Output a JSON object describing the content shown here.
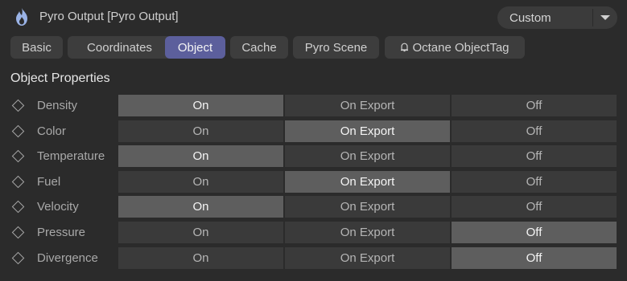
{
  "header": {
    "title": "Pyro Output [Pyro Output]",
    "preset": "Custom",
    "flame_icon": "pyro-flame-icon",
    "arrow_icon": "chevron-down-icon"
  },
  "tabs": [
    {
      "label": "Basic",
      "active": false
    },
    {
      "label": "Coordinates",
      "active": false
    },
    {
      "label": "Object",
      "active": true
    },
    {
      "label": "Cache",
      "active": false
    },
    {
      "label": "Pyro Scene",
      "active": false
    },
    {
      "label": "Octane ObjectTag",
      "active": false,
      "icon": "bell-icon"
    }
  ],
  "section": {
    "title": "Object Properties"
  },
  "options": [
    "On",
    "On Export",
    "Off"
  ],
  "properties": [
    {
      "label": "Density",
      "value": "On"
    },
    {
      "label": "Color",
      "value": "On Export"
    },
    {
      "label": "Temperature",
      "value": "On"
    },
    {
      "label": "Fuel",
      "value": "On Export"
    },
    {
      "label": "Velocity",
      "value": "On"
    },
    {
      "label": "Pressure",
      "value": "Off"
    },
    {
      "label": "Divergence",
      "value": "Off"
    }
  ],
  "colors": {
    "background": "#2b2b2b",
    "tab": "#3d3d3d",
    "tab_active": "#5c5f9c",
    "segment": "#3a3a3a",
    "segment_selected": "#5e5e5e",
    "flame": "#9ab3e6"
  }
}
